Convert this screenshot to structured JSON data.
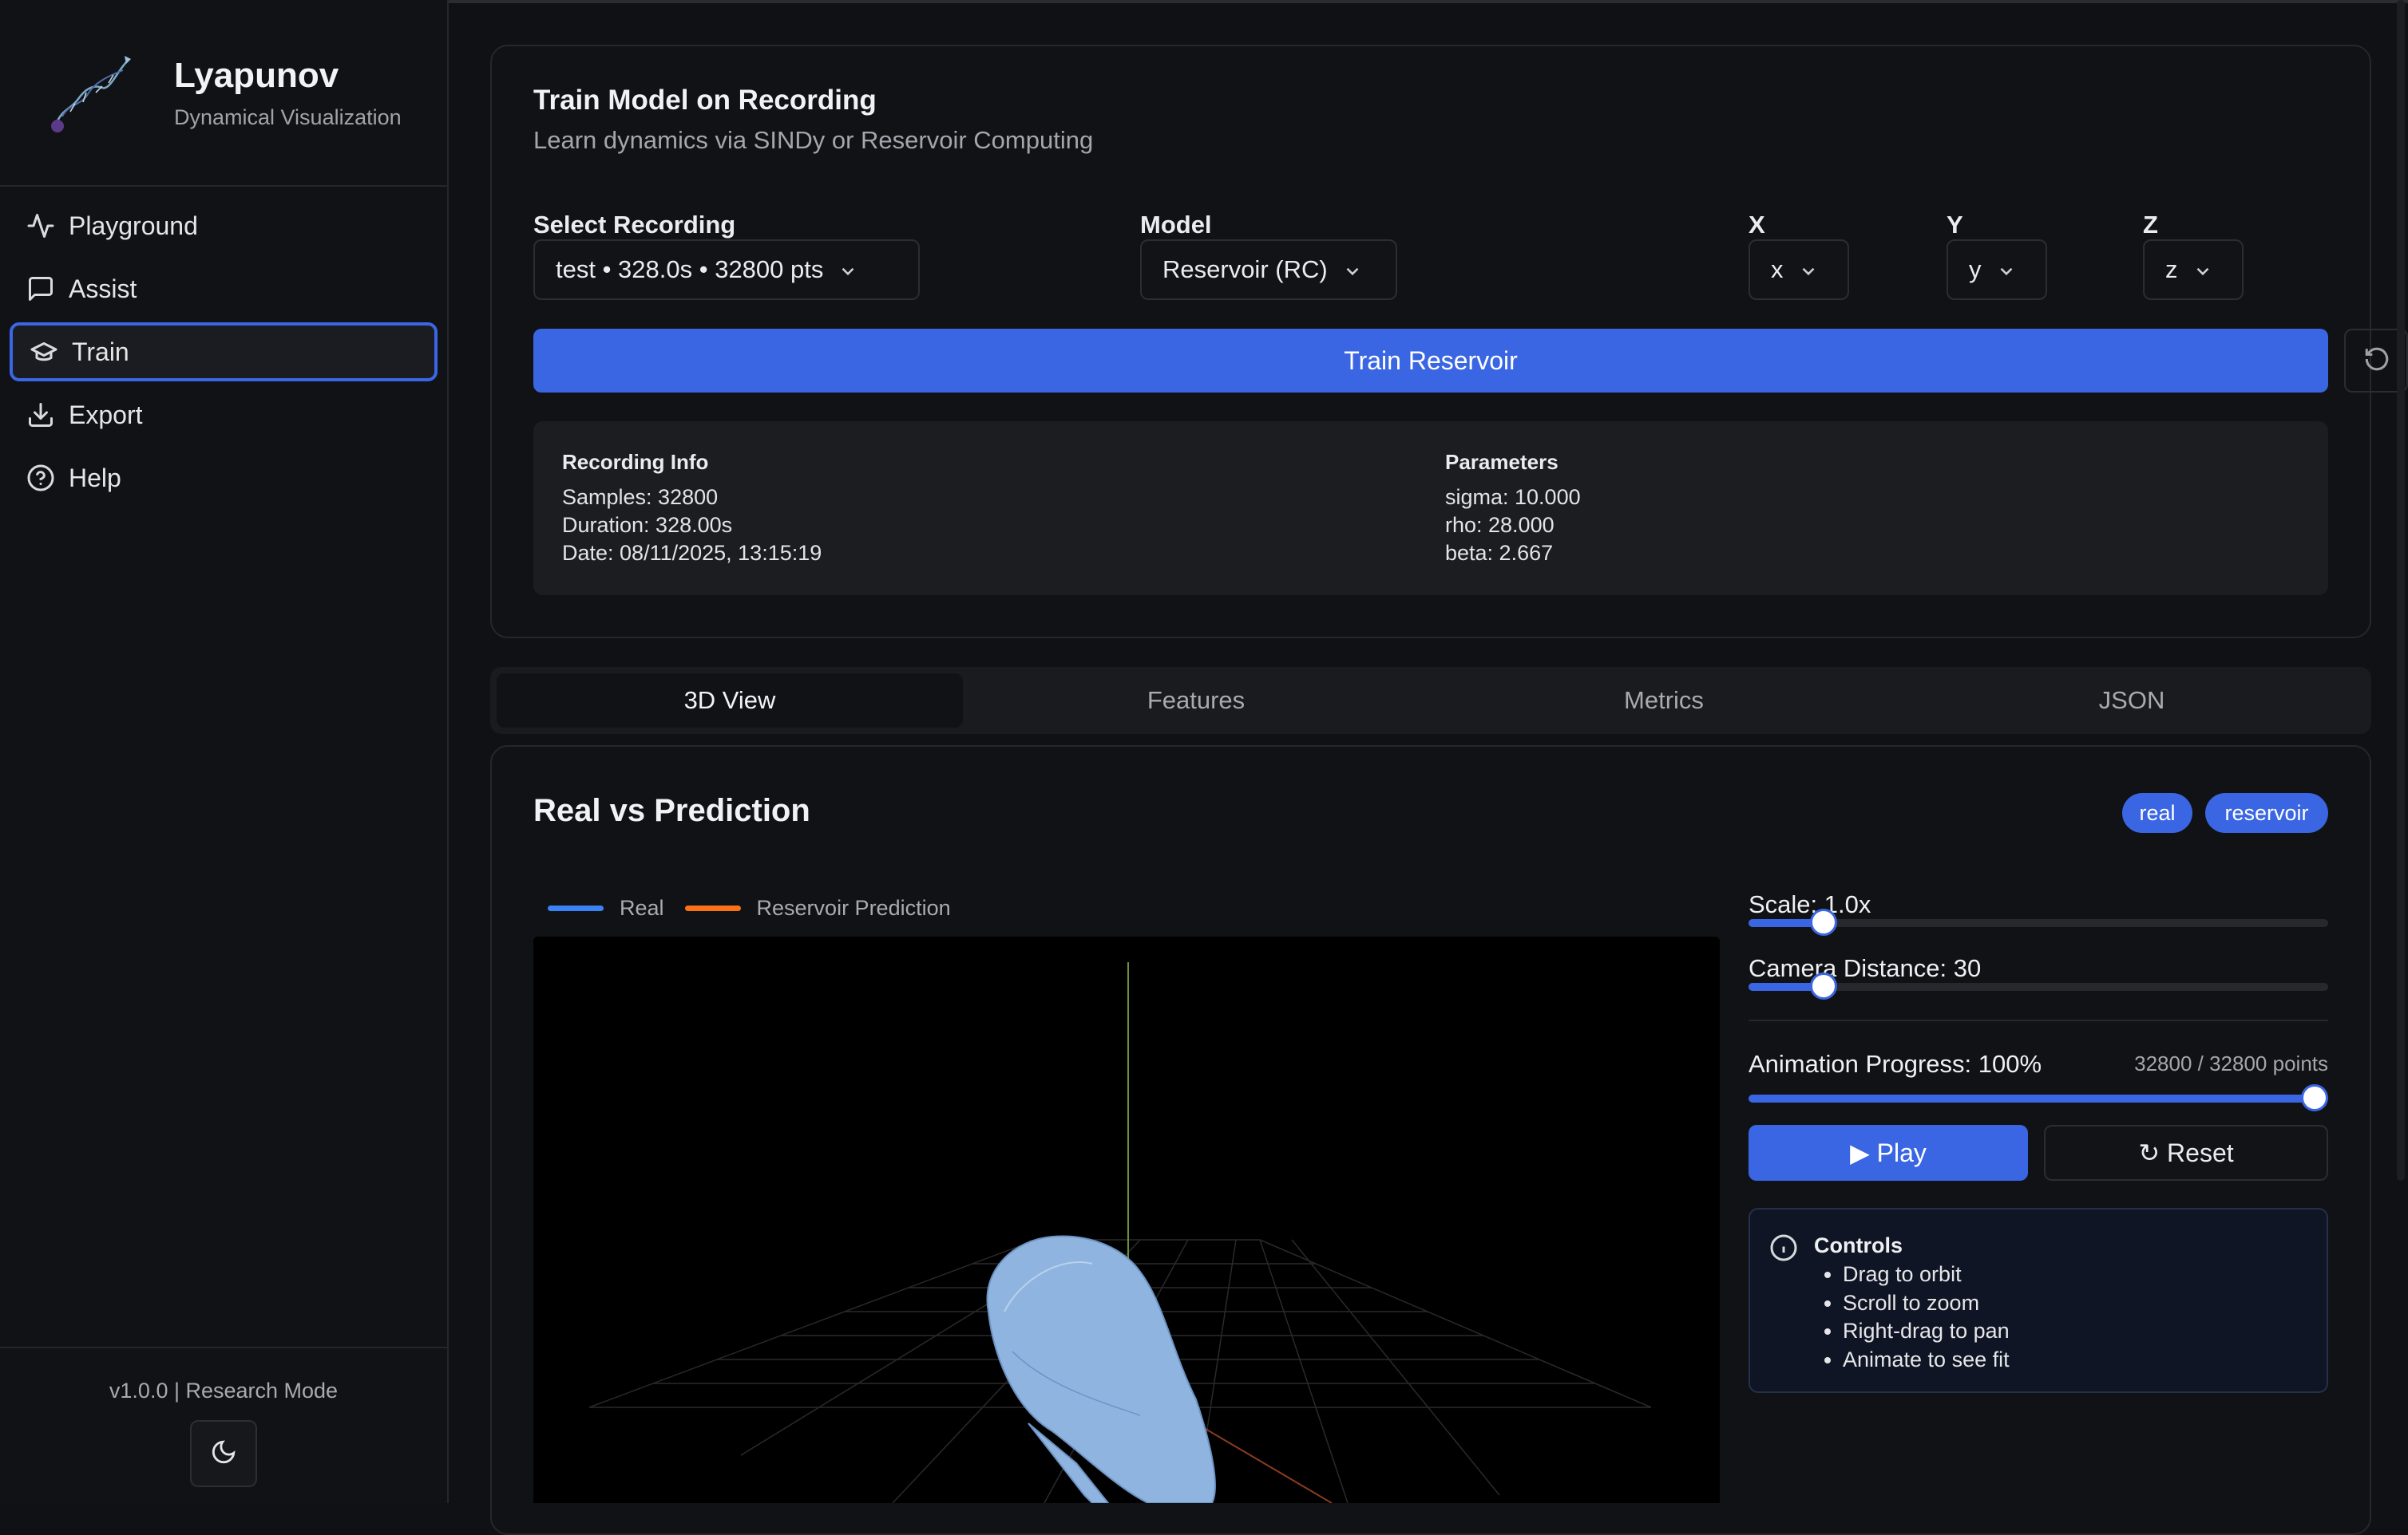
{
  "app": {
    "title": "Lyapunov",
    "subtitle": "Dynamical Visualization",
    "version": "v1.0.0 | Research Mode"
  },
  "sidebar": {
    "items": [
      {
        "label": "Playground",
        "icon": "activity-icon"
      },
      {
        "label": "Assist",
        "icon": "message-icon"
      },
      {
        "label": "Train",
        "icon": "graduation-cap-icon",
        "active": true
      },
      {
        "label": "Export",
        "icon": "download-icon"
      },
      {
        "label": "Help",
        "icon": "help-circle-icon"
      }
    ]
  },
  "train": {
    "title": "Train Model on Recording",
    "subtitle": "Learn dynamics via SINDy or Reservoir Computing",
    "recording_label": "Select Recording",
    "recording_value": "test • 328.0s • 32800 pts",
    "model_label": "Model",
    "model_value": "Reservoir (RC)",
    "x_label": "X",
    "x_value": "x",
    "y_label": "Y",
    "y_value": "y",
    "z_label": "Z",
    "z_value": "z",
    "train_button": "Train Reservoir",
    "recording_info": {
      "title": "Recording Info",
      "samples": "Samples: 32800",
      "duration": "Duration: 328.00s",
      "date": "Date: 08/11/2025, 13:15:19"
    },
    "parameters": {
      "title": "Parameters",
      "sigma": "sigma: 10.000",
      "rho": "rho: 28.000",
      "beta": "beta: 2.667"
    }
  },
  "tabs": [
    "3D View",
    "Features",
    "Metrics",
    "JSON"
  ],
  "active_tab": "3D View",
  "viz": {
    "title": "Real vs Prediction",
    "badges": [
      "real",
      "reservoir"
    ],
    "legend": [
      {
        "label": "Real",
        "color": "#3b82f6"
      },
      {
        "label": "Reservoir Prediction",
        "color": "#f97316"
      }
    ],
    "scale_label": "Scale: 1.0x",
    "scale_fraction": 0.13,
    "camera_label": "Camera Distance: 30",
    "camera_fraction": 0.13,
    "progress_label": "Animation Progress: 100%",
    "progress_fraction": 1.0,
    "points": "32800 / 32800 points",
    "play_button": "▶ Play",
    "reset_button": "↻ Reset",
    "controls_title": "Controls",
    "controls": [
      "Drag to orbit",
      "Scroll to zoom",
      "Right-drag to pan",
      "Animate to see fit"
    ]
  },
  "colors": {
    "accent": "#3a66e3",
    "real": "#8fb4e0",
    "prediction": "#f97316"
  }
}
